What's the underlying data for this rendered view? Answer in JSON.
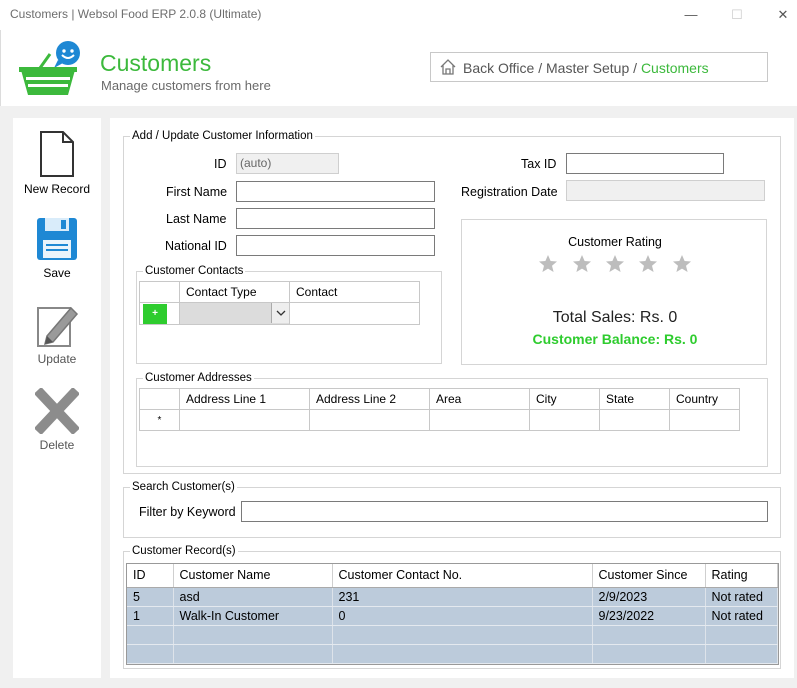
{
  "window": {
    "title": "Customers | Websol Food ERP 2.0.8 (Ultimate)",
    "minimize": "—",
    "maximize": "☐",
    "close": "✕"
  },
  "header": {
    "title": "Customers",
    "subtitle": "Manage customers from here"
  },
  "breadcrumb": {
    "trail": "Back Office / Master Setup / ",
    "current": "Customers"
  },
  "sidebar": {
    "new_record": "New Record",
    "save": "Save",
    "update": "Update",
    "delete": "Delete"
  },
  "form": {
    "legend": "Add / Update Customer Information",
    "id_label": "ID",
    "id_value": "(auto)",
    "first_name_label": "First Name",
    "last_name_label": "Last Name",
    "national_id_label": "National ID",
    "tax_id_label": "Tax ID",
    "registration_date_label": "Registration Date"
  },
  "contacts": {
    "legend": "Customer Contacts",
    "col_type": "Contact Type",
    "col_contact": "Contact",
    "add_symbol": "+"
  },
  "rating": {
    "title": "Customer Rating",
    "total_sales": "Total Sales: Rs. 0",
    "balance": "Customer Balance: Rs. 0",
    "stars": 0
  },
  "addresses": {
    "legend": "Customer Addresses",
    "columns": [
      "Address Line 1",
      "Address Line 2",
      "Area",
      "City",
      "State",
      "Country"
    ],
    "new_row_marker": "*"
  },
  "search": {
    "legend": "Search Customer(s)",
    "filter_label": "Filter by Keyword",
    "value": ""
  },
  "records": {
    "legend": "Customer Record(s)",
    "columns": [
      "ID",
      "Customer Name",
      "Customer Contact No.",
      "Customer Since",
      "Rating"
    ],
    "rows": [
      [
        "5",
        "asd",
        "231",
        "2/9/2023",
        "Not rated"
      ],
      [
        "1",
        "Walk-In Customer",
        "0",
        "9/23/2022",
        "Not rated"
      ]
    ]
  },
  "colors": {
    "accent_green": "#3cb93c",
    "save_blue": "#1e88d4",
    "grid_bg": "#bccbdb"
  }
}
